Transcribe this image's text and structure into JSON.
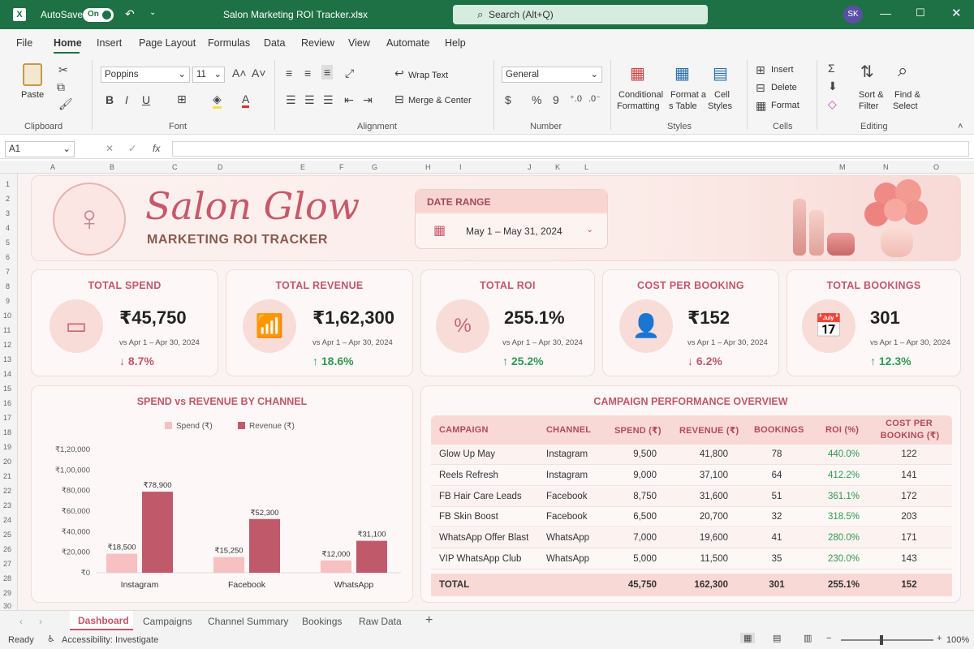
{
  "titlebar": {
    "autosave": "AutoSave",
    "toggle": "On",
    "filename": "Salon Marketing ROI Tracker.xlsx",
    "search": "Search (Alt+Q)",
    "avatar": "SK"
  },
  "menu": [
    "File",
    "Home",
    "Insert",
    "Page Layout",
    "Formulas",
    "Data",
    "Review",
    "View",
    "Automate",
    "Help"
  ],
  "ribbon": {
    "paste": "Paste",
    "clipboard": "Clipboard",
    "font_name": "Poppins",
    "font_size": "11",
    "font": "Font",
    "wrap": "Wrap Text",
    "merge": "Merge & Center",
    "alignment": "Alignment",
    "number_format": "General",
    "number": "Number",
    "cond1": "Conditional",
    "cond2": "Formatting",
    "fmt1": "Format a",
    "fmt2": "s Table",
    "cell1": "Cell",
    "cell2": "Styles",
    "styles": "Styles",
    "insert": "Insert",
    "delete": "Delete",
    "format": "Format",
    "cells": "Cells",
    "sort1": "Sort &",
    "sort2": "Filter",
    "find1": "Find &",
    "find2": "Select",
    "editing": "Editing"
  },
  "formula": {
    "namebox": "A1",
    "fx": "fx"
  },
  "columns": [
    "A",
    "B",
    "C",
    "D",
    "E",
    "F",
    "G",
    "H",
    "I",
    "J",
    "K",
    "L",
    "M",
    "N",
    "O"
  ],
  "rows": [
    "1",
    "2",
    "3",
    "4",
    "5",
    "6",
    "7",
    "8",
    "9",
    "10",
    "11",
    "12",
    "13",
    "14",
    "15",
    "16",
    "17",
    "18",
    "19",
    "20",
    "21",
    "22",
    "23",
    "24",
    "25",
    "26",
    "27",
    "28",
    "29",
    "30"
  ],
  "header": {
    "brand": "Salon Glow",
    "subtitle": "MARKETING ROI TRACKER",
    "date_label": "DATE RANGE",
    "date_value": "May 1 – May 31, 2024"
  },
  "kpis": [
    {
      "title": "TOTAL SPEND",
      "value": "₹45,750",
      "sub": "vs Apr 1 – Apr 30, 2024",
      "change": "↓ 8.7%",
      "dir": "down",
      "icon": "wallet-icon"
    },
    {
      "title": "TOTAL REVENUE",
      "value": "₹1,62,300",
      "sub": "vs Apr 1 – Apr 30, 2024",
      "change": "↑ 18.6%",
      "dir": "up",
      "icon": "bar-chart-icon"
    },
    {
      "title": "TOTAL ROI",
      "value": "255.1%",
      "sub": "vs Apr 1 – Apr 30, 2024",
      "change": "↑ 25.2%",
      "dir": "up",
      "icon": "percent-icon"
    },
    {
      "title": "COST PER BOOKING",
      "value": "₹152",
      "sub": "vs Apr 1 – Apr 30, 2024",
      "change": "↓ 6.2%",
      "dir": "down",
      "icon": "user-icon"
    },
    {
      "title": "TOTAL BOOKINGS",
      "value": "301",
      "sub": "vs Apr 1 – Apr 30, 2024",
      "change": "↑ 12.3%",
      "dir": "up",
      "icon": "calendar-icon"
    }
  ],
  "chart_data": {
    "type": "bar",
    "title": "SPEND vs REVENUE BY CHANNEL",
    "categories": [
      "Instagram",
      "Facebook",
      "WhatsApp"
    ],
    "series": [
      {
        "name": "Spend (₹)",
        "values": [
          18500,
          15250,
          12000
        ],
        "labels": [
          "₹18,500",
          "₹15,250",
          "₹12,000"
        ],
        "color": "#f6c1c0"
      },
      {
        "name": "Revenue (₹)",
        "values": [
          78900,
          52300,
          31100
        ],
        "labels": [
          "₹78,900",
          "₹52,300",
          "₹31,100"
        ],
        "color": "#c05a6a"
      }
    ],
    "yticks": [
      "₹0",
      "₹20,000",
      "₹40,000",
      "₹60,000",
      "₹80,000",
      "₹1,00,000",
      "₹1,20,000"
    ],
    "ylim": [
      0,
      120000
    ],
    "legend": "top"
  },
  "table": {
    "title": "CAMPAIGN PERFORMANCE OVERVIEW",
    "headers": [
      "CAMPAIGN",
      "CHANNEL",
      "SPEND (₹)",
      "REVENUE (₹)",
      "BOOKINGS",
      "ROI (%)",
      "COST PER",
      "BOOKING (₹)"
    ],
    "rows": [
      [
        "Glow Up May",
        "Instagram",
        "9,500",
        "41,800",
        "78",
        "440.0%",
        "122"
      ],
      [
        "Reels Refresh",
        "Instagram",
        "9,000",
        "37,100",
        "64",
        "412.2%",
        "141"
      ],
      [
        "FB Hair Care Leads",
        "Facebook",
        "8,750",
        "31,600",
        "51",
        "361.1%",
        "172"
      ],
      [
        "FB Skin Boost",
        "Facebook",
        "6,500",
        "20,700",
        "32",
        "318.5%",
        "203"
      ],
      [
        "WhatsApp Offer Blast",
        "WhatsApp",
        "7,000",
        "19,600",
        "41",
        "280.0%",
        "171"
      ],
      [
        "VIP WhatsApp Club",
        "WhatsApp",
        "5,000",
        "11,500",
        "35",
        "230.0%",
        "143"
      ]
    ],
    "total": [
      "TOTAL",
      "",
      "45,750",
      "162,300",
      "301",
      "255.1%",
      "152"
    ]
  },
  "tabs": [
    "Dashboard",
    "Campaigns",
    "Channel Summary",
    "Bookings",
    "Raw Data",
    "+"
  ],
  "status": {
    "ready": "Ready",
    "access": "Accessibility: Investigate",
    "zoom": "100%"
  },
  "colors": {
    "accent": "#c2566a",
    "excel_green": "#1e7145",
    "up": "#2d9a4e"
  }
}
